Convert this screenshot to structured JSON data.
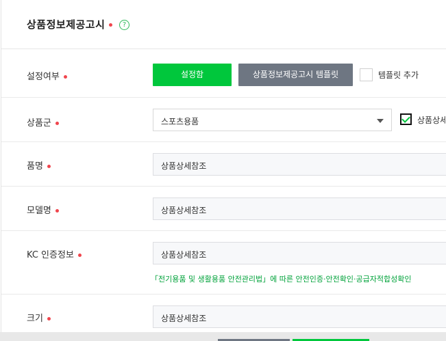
{
  "header": {
    "title": "상품정보제공고시",
    "help_icon": "?"
  },
  "rows": {
    "setting": {
      "label": "설정여부",
      "set_button": "설정함",
      "template_button": "상품정보제공고시 템플릿",
      "add_template_label": "템플릿 추가"
    },
    "category": {
      "label": "상품군",
      "selected": "스포츠용품",
      "detail_checkbox_label": "상품상세",
      "detail_checked": true
    },
    "product_name": {
      "label": "품명",
      "value": "상품상세참조"
    },
    "model_name": {
      "label": "모델명",
      "value": "상품상세참조"
    },
    "kc": {
      "label": "KC 인증정보",
      "value": "상품상세참조",
      "notice": "「전기용품 및 생활용품 안전관리법」에 따른 안전인증·안전확인·공급자적합성확인"
    },
    "size": {
      "label": "크기",
      "value": "상품상세참조"
    }
  },
  "colors": {
    "accent_green": "#00c73c",
    "required_red": "#f0454d",
    "template_gray": "#6e7682"
  }
}
